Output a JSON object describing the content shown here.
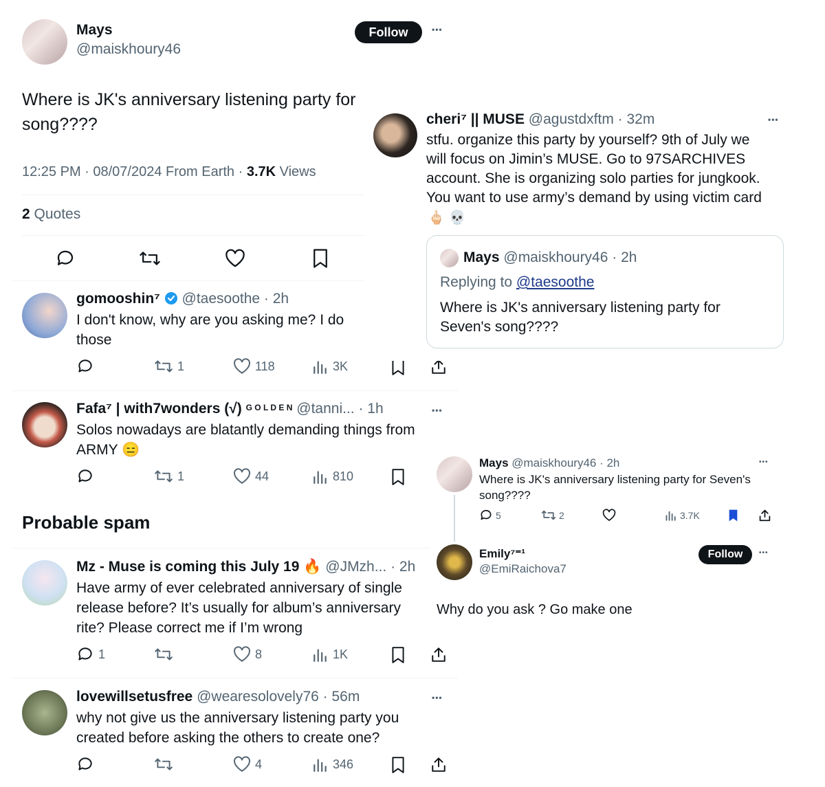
{
  "main_tweet": {
    "author_name": "Mays",
    "handle": "@maiskhoury46",
    "follow_label": "Follow",
    "more": "•••",
    "text_line1": "Where is JK's anniversary listening party for",
    "text_line2": "song????",
    "time": "12:25 PM · 08/07/2024 From Earth · ",
    "views_count": "3.7K",
    "views_label": " Views",
    "quotes_count": "2",
    "quotes_label": " Quotes"
  },
  "replies": [
    {
      "name": "gomooshin⁷",
      "handle": "@taesoothe · 2h",
      "line1": "I don't know, why are you asking me? I do",
      "line2": "those",
      "retweets": "1",
      "likes": "118",
      "views": "3K"
    },
    {
      "name": "Fafa⁷ | with7wonders (√)",
      "golden": "G O L D E N",
      "handle": "@tanni... · 1h",
      "line1": "Solos nowadays are blatantly demanding things from",
      "line2": "ARMY",
      "emoji": "😑",
      "retweets": "1",
      "likes": "44",
      "views": "810"
    }
  ],
  "spam_heading": "Probable spam",
  "spam_replies": [
    {
      "name": "Mz - Muse is coming this July 19",
      "emoji": "🔥",
      "handle": "@JMzh... · 2h",
      "line1": "Have army of ever celebrated anniversary of single",
      "line2": "release before? It’s usually for album’s anniversary",
      "line3": "rite? Please correct me if I’m wrong",
      "comments": "1",
      "likes": "8",
      "views": "1K"
    },
    {
      "name": "lovewillsetusfree",
      "handle": "@wearesolovely76 · 56m",
      "line1": "why not give us the anniversary listening party you",
      "line2": "created before asking the others to create one?",
      "likes": "4",
      "views": "346"
    }
  ],
  "cheri": {
    "name": "cheri⁷ || MUSE",
    "handle": "@agustdxftm · 32m",
    "more": "•••",
    "line1": "stfu. organize this party by yourself? 9th of July we",
    "line2": "will focus on Jimin’s MUSE. Go to 97SARCHIVES",
    "line3": "account. She is organizing solo parties for jungkook.",
    "line4": "You want to use army’s demand by using victim card",
    "emojis": "🖕🏻 💀",
    "quoted": {
      "name": "Mays",
      "handle": "@maiskhoury46 · 2h",
      "replying_prefix": "Replying to ",
      "replying_to": "@taesoothe",
      "line1": "Where is JK's anniversary listening party for",
      "line2": "Seven's song????"
    }
  },
  "thread": {
    "tweet": {
      "name": "Mays",
      "handle": "@maiskhoury46 · 2h",
      "more": "•••",
      "line1": "Where is JK's anniversary listening party for Seven's",
      "line2": "song????",
      "comments": "5",
      "retweets": "2",
      "views": "3.7K"
    },
    "reply": {
      "name": "Emily⁷⁼¹",
      "handle": "@EmiRaichova7",
      "follow_label": "Follow",
      "more": "•••",
      "text": "Why do you ask ? Go make one"
    }
  },
  "colors": {
    "text": "#0f1419",
    "muted": "#536471",
    "verified": "#1d9bf0",
    "bookmark_filled": "#1d4ed8"
  }
}
